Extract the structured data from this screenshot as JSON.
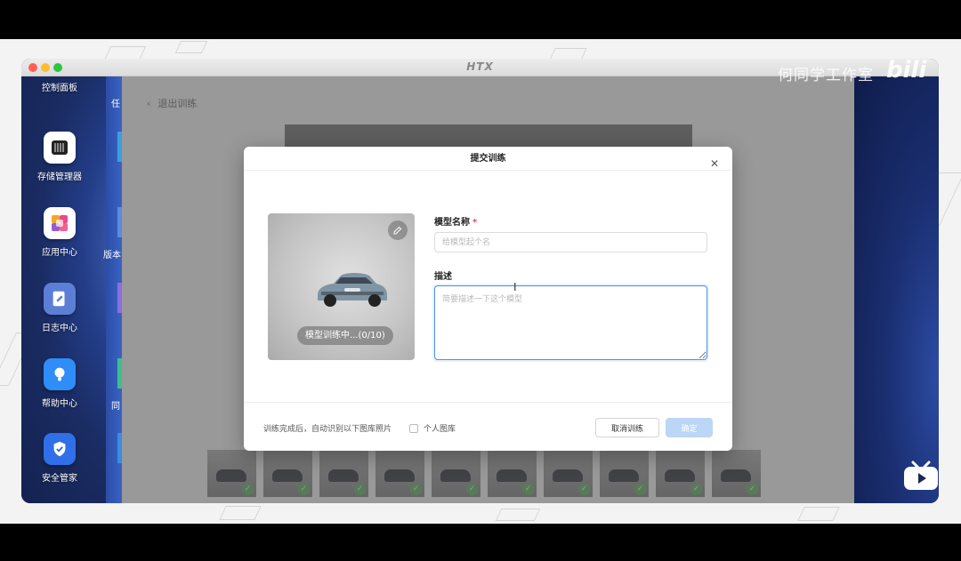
{
  "window": {
    "logo": "HTX"
  },
  "desktop": {
    "apps": [
      {
        "label": "控制面板",
        "icon": "control-panel-icon"
      },
      {
        "label": "存储管理器",
        "icon": "storage-manager-icon"
      },
      {
        "label": "应用中心",
        "icon": "app-center-icon"
      },
      {
        "label": "日志中心",
        "icon": "log-center-icon"
      },
      {
        "label": "帮助中心",
        "icon": "help-center-icon"
      },
      {
        "label": "安全管家",
        "icon": "security-icon"
      }
    ],
    "clipped_labels": [
      "任",
      "版本",
      "同"
    ]
  },
  "app": {
    "back_label": "退出训练"
  },
  "dialog": {
    "title": "提交训练",
    "photo_badge": "模型训练中...(0/10)",
    "name_label": "模型名称",
    "name_required": "*",
    "name_placeholder": "给模型起个名",
    "desc_label": "描述",
    "desc_placeholder": "简要描述一下这个模型",
    "footer_text": "训练完成后，自动识别以下图库照片",
    "personal_library_label": "个人图库",
    "personal_library_checked": false,
    "cancel_label": "取消训练",
    "ok_label": "确定"
  },
  "thumbnails_count": 10,
  "watermark": {
    "channel": "何同学工作室",
    "platform": "bilibili"
  },
  "colors": {
    "accent": "#4a90e2",
    "ok_disabled": "#bcd6f6",
    "required": "#e34d4d",
    "check": "#8fcf8f"
  }
}
